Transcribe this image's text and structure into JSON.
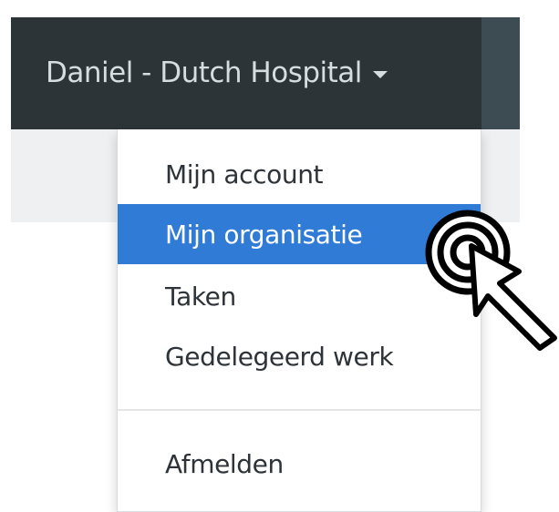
{
  "navbar": {
    "user_label": "Daniel - Dutch Hospital"
  },
  "dropdown": {
    "items": [
      {
        "label": "Mijn account"
      },
      {
        "label": "Mijn organisatie",
        "active": true
      },
      {
        "label": "Taken"
      },
      {
        "label": "Gedelegeerd werk"
      },
      {
        "label": "Afmelden"
      }
    ]
  },
  "icons": {
    "caret": "caret-down-icon",
    "cursor": "click-pointer-icon"
  },
  "colors": {
    "navbar_bg": "#2c3438",
    "active_item_bg": "#2f7bd6",
    "subbar_bg": "#eef0f2"
  }
}
